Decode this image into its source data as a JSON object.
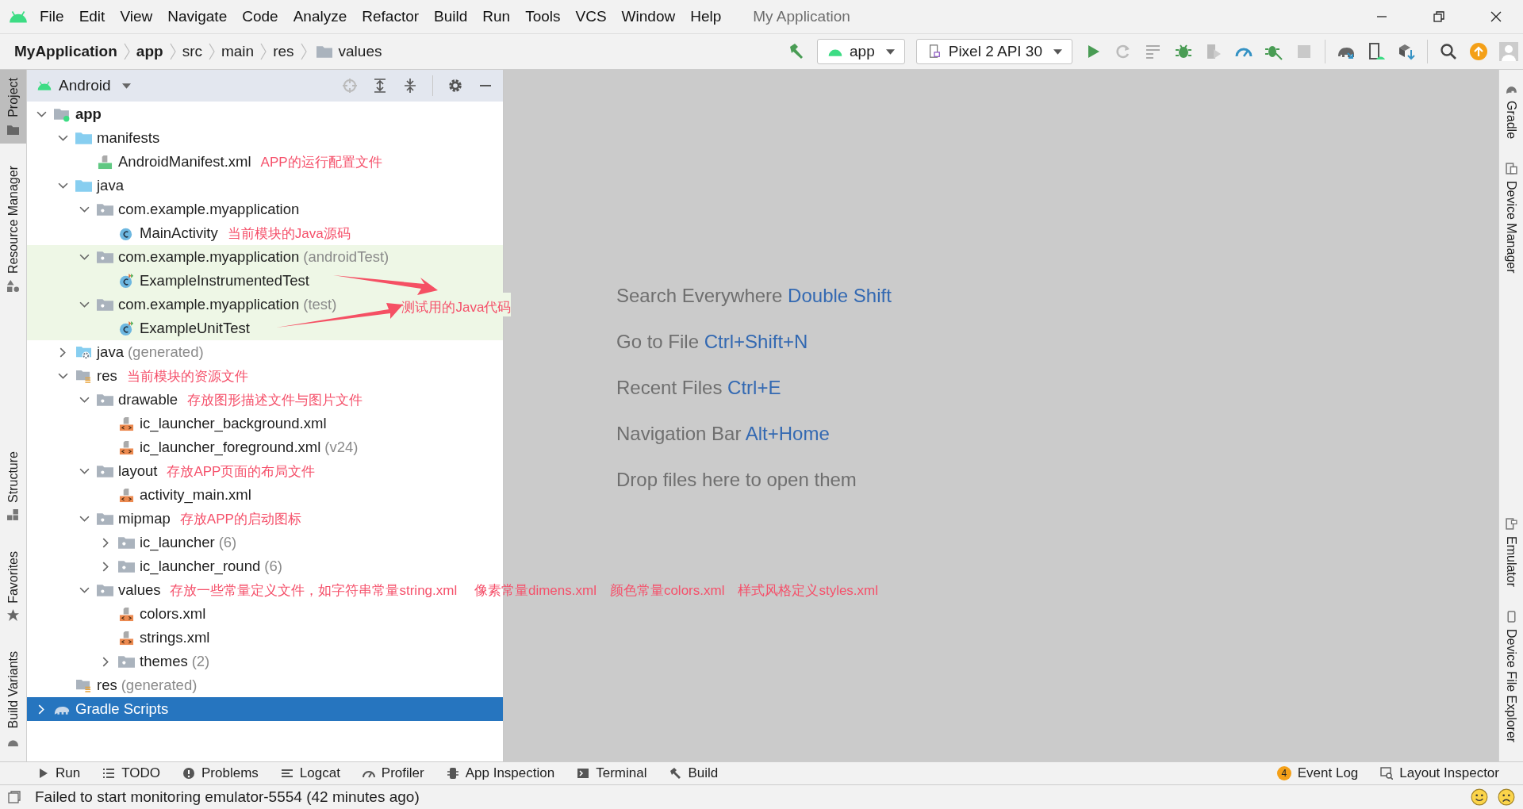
{
  "window": {
    "title": "My Application",
    "menu": [
      "File",
      "Edit",
      "View",
      "Navigate",
      "Code",
      "Analyze",
      "Refactor",
      "Build",
      "Run",
      "Tools",
      "VCS",
      "Window",
      "Help"
    ]
  },
  "breadcrumb": [
    {
      "label": "MyApplication",
      "kind": "module"
    },
    {
      "label": "app",
      "kind": "module"
    },
    {
      "label": "src",
      "kind": "directory"
    },
    {
      "label": "main",
      "kind": "directory"
    },
    {
      "label": "res",
      "kind": "directory"
    },
    {
      "label": "values",
      "kind": "folder"
    }
  ],
  "toolbar": {
    "run_config": "app",
    "device": "Pixel 2 API 30"
  },
  "left_strip": {
    "top": [
      {
        "label": "Project",
        "selected": true
      },
      {
        "label": "Resource Manager",
        "selected": false
      }
    ],
    "bottom": [
      {
        "label": "Structure",
        "selected": false
      },
      {
        "label": "Favorites",
        "selected": false
      },
      {
        "label": "Build Variants",
        "selected": false
      }
    ]
  },
  "right_strip": {
    "top": [
      {
        "label": "Gradle"
      },
      {
        "label": "Device Manager"
      }
    ],
    "bottom": [
      {
        "label": "Emulator"
      },
      {
        "label": "Device File Explorer"
      }
    ]
  },
  "project_panel": {
    "view": "Android",
    "tree": [
      {
        "label": "app",
        "kind": "module",
        "expanded": true,
        "selected": false,
        "highlighted": false,
        "children": [
          {
            "label": "manifests",
            "kind": "folder",
            "expanded": true,
            "selected": false,
            "highlighted": false,
            "children": [
              {
                "label": "AndroidManifest.xml",
                "kind": "manifest",
                "note": "APP的运行配置文件",
                "selected": false,
                "highlighted": false
              }
            ]
          },
          {
            "label": "java",
            "kind": "folder",
            "expanded": true,
            "selected": false,
            "highlighted": false,
            "children": [
              {
                "label": "com.example.myapplication",
                "kind": "package",
                "expanded": true,
                "selected": false,
                "highlighted": false,
                "children": [
                  {
                    "label": "MainActivity",
                    "kind": "class",
                    "note": "当前模块的Java源码",
                    "selected": false,
                    "highlighted": false
                  }
                ]
              },
              {
                "label": "com.example.myapplication",
                "suffix": "(androidTest)",
                "kind": "package",
                "expanded": true,
                "selected": false,
                "highlighted": true,
                "children": [
                  {
                    "label": "ExampleInstrumentedTest",
                    "kind": "test_class",
                    "selected": false,
                    "highlighted": true
                  }
                ]
              },
              {
                "label": "com.example.myapplication",
                "suffix": "(test)",
                "note": "测试用的Java代码",
                "kind": "package",
                "expanded": true,
                "selected": false,
                "highlighted": true,
                "children": [
                  {
                    "label": "ExampleUnitTest",
                    "kind": "test_class",
                    "selected": false,
                    "highlighted": true
                  }
                ]
              }
            ]
          },
          {
            "label": "java",
            "suffix": "(generated)",
            "kind": "generated_java",
            "expanded": false,
            "selected": false,
            "highlighted": false
          },
          {
            "label": "res",
            "kind": "res",
            "note": "当前模块的资源文件",
            "expanded": true,
            "selected": false,
            "highlighted": false,
            "children": [
              {
                "label": "drawable",
                "kind": "package",
                "note": "存放图形描述文件与图片文件",
                "expanded": true,
                "selected": false,
                "highlighted": false,
                "children": [
                  {
                    "label": "ic_launcher_background.xml",
                    "kind": "xml",
                    "selected": false,
                    "highlighted": false
                  },
                  {
                    "label": "ic_launcher_foreground.xml",
                    "suffix": "(v24)",
                    "kind": "xml",
                    "selected": false,
                    "highlighted": false
                  }
                ]
              },
              {
                "label": "layout",
                "kind": "package",
                "note": "存放APP页面的布局文件",
                "expanded": true,
                "selected": false,
                "highlighted": false,
                "children": [
                  {
                    "label": "activity_main.xml",
                    "kind": "xml",
                    "selected": false,
                    "highlighted": false
                  }
                ]
              },
              {
                "label": "mipmap",
                "kind": "package",
                "note": "存放APP的启动图标",
                "expanded": true,
                "selected": false,
                "highlighted": false,
                "children": [
                  {
                    "label": "ic_launcher",
                    "suffix": "(6)",
                    "kind": "package",
                    "expanded": false,
                    "selected": false,
                    "highlighted": false
                  },
                  {
                    "label": "ic_launcher_round",
                    "suffix": "(6)",
                    "kind": "package",
                    "expanded": false,
                    "selected": false,
                    "highlighted": false
                  }
                ]
              },
              {
                "label": "values",
                "kind": "package",
                "note": "存放一些常量定义文件，如字符串常量string.xml　 像素常量dimens.xml　颜色常量colors.xml　样式风格定义styles.xml",
                "expanded": true,
                "selected": false,
                "highlighted": false,
                "children": [
                  {
                    "label": "colors.xml",
                    "kind": "xml",
                    "selected": false,
                    "highlighted": false
                  },
                  {
                    "label": "strings.xml",
                    "kind": "xml",
                    "selected": false,
                    "highlighted": false
                  },
                  {
                    "label": "themes",
                    "suffix": "(2)",
                    "kind": "package",
                    "expanded": false,
                    "selected": false,
                    "highlighted": false
                  }
                ]
              }
            ]
          },
          {
            "label": "res",
            "suffix": "(generated)",
            "kind": "res",
            "selected": false,
            "highlighted": false
          }
        ]
      },
      {
        "label": "Gradle Scripts",
        "kind": "gradle",
        "expanded": false,
        "selected": true,
        "highlighted": false
      }
    ]
  },
  "editor_hints": [
    {
      "label": "Search Everywhere",
      "shortcut": "Double Shift"
    },
    {
      "label": "Go to File",
      "shortcut": "Ctrl+Shift+N"
    },
    {
      "label": "Recent Files",
      "shortcut": "Ctrl+E"
    },
    {
      "label": "Navigation Bar",
      "shortcut": "Alt+Home"
    },
    {
      "label": "Drop files here to open them"
    }
  ],
  "bottom_tools": {
    "left": [
      {
        "label": "Run",
        "kind": "run"
      },
      {
        "label": "TODO",
        "kind": "todo"
      },
      {
        "label": "Problems",
        "kind": "problems"
      },
      {
        "label": "Logcat",
        "kind": "logcat"
      },
      {
        "label": "Profiler",
        "kind": "profiler"
      },
      {
        "label": "App Inspection",
        "kind": "inspection"
      },
      {
        "label": "Terminal",
        "kind": "terminal"
      },
      {
        "label": "Build",
        "kind": "build"
      }
    ],
    "right": [
      {
        "label": "Event Log",
        "kind": "event_log",
        "badge": "4"
      },
      {
        "label": "Layout Inspector",
        "kind": "layout_inspector"
      }
    ]
  },
  "status_bar": {
    "message": "Failed to start monitoring emulator-5554 (42 minutes ago)"
  }
}
